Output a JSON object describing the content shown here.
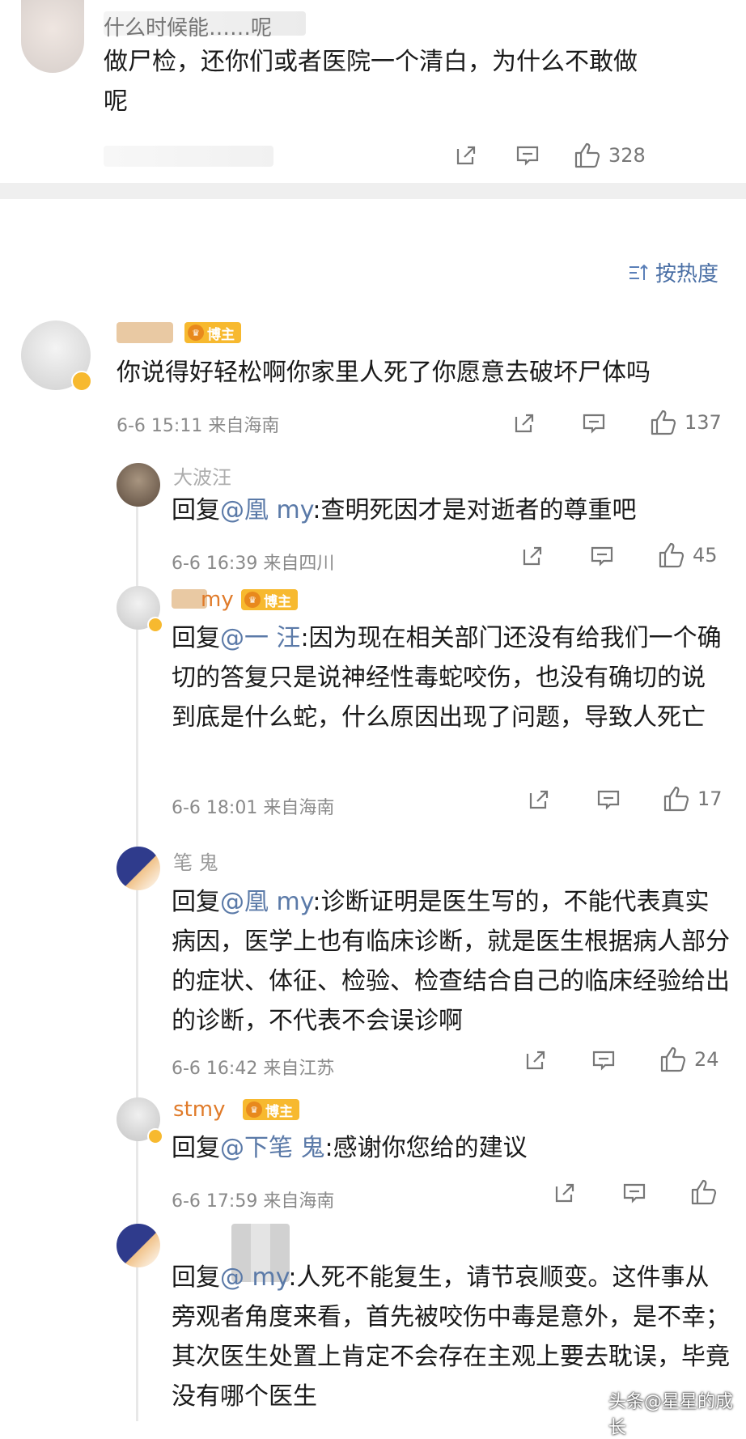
{
  "top_comment": {
    "name_partial": "什么时候能……呢",
    "text": "做尸检，还你们或者医院一个清白，为什么不敢做呢",
    "like_count": "328"
  },
  "sort": {
    "label": "按热度"
  },
  "comment": {
    "badge": "博主",
    "text": "你说得好轻松啊你家里人死了你愿意去破坏尸体吗",
    "meta": "6-6 15:11 来自海南",
    "like_count": "137"
  },
  "replies": [
    {
      "name_partial": "大波汪",
      "reply_prefix": "回复",
      "mention": "@凰 my",
      "text": ":查明死因才是对逝者的尊重吧",
      "meta": "6-6 16:39 来自四川",
      "like_count": "45"
    },
    {
      "name_partial": "my",
      "badge": "博主",
      "reply_prefix": "回复",
      "mention": "@一 汪",
      "text": ":因为现在相关部门还没有给我们一个确切的答复只是说神经性毒蛇咬伤，也没有确切的说到底是什么蛇，什么原因出现了问题，导致人死亡",
      "meta": "6-6 18:01 来自海南",
      "like_count": "17"
    },
    {
      "name_partial": "笔 鬼",
      "reply_prefix": "回复",
      "mention": "@凰 my",
      "text": ":诊断证明是医生写的，不能代表真实病因，医学上也有临床诊断，就是医生根据病人部分的症状、体征、检验、检查结合自己的临床经验给出的诊断，不代表不会误诊啊",
      "meta": "6-6 16:42 来自江苏",
      "like_count": "24"
    },
    {
      "name_partial": "stmy",
      "badge": "博主",
      "reply_prefix": "回复",
      "mention": "@下笔 鬼",
      "text": ":感谢你您给的建议",
      "meta": "6-6 17:59 来自海南",
      "like_count": ""
    },
    {
      "name_partial": "",
      "reply_prefix": "回复",
      "mention": "@ my",
      "text": ":人死不能复生，请节哀顺变。这件事从旁观者角度来看，首先被咬伤中毒是意外，是不幸；其次医生处置上肯定不会存在主观上要去耽误，毕竟没有哪个医生",
      "watermark": "头条@星星的成长"
    }
  ],
  "icons": {
    "share": "share-icon",
    "comment": "comment-icon",
    "like": "thumbs-up-icon",
    "sort": "sort-icon",
    "badge": "crown-icon"
  },
  "colors": {
    "mention": "#5b7aa8",
    "badge": "#f7b92f",
    "meta": "#8a8a8a"
  }
}
